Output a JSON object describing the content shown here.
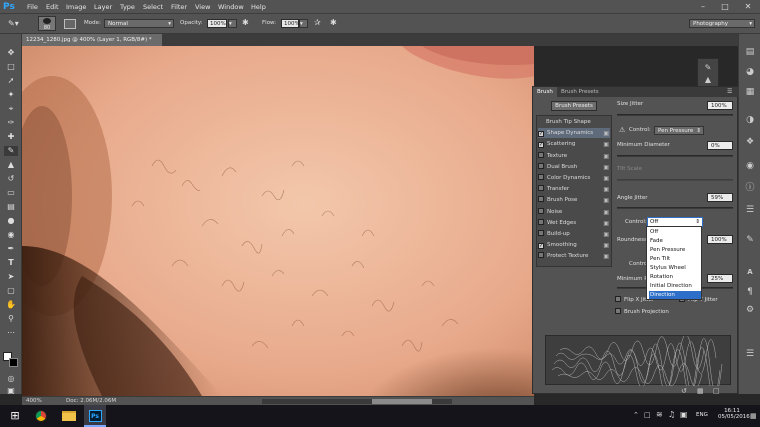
{
  "app": {
    "logo": "Ps"
  },
  "menu": [
    "File",
    "Edit",
    "Image",
    "Layer",
    "Type",
    "Select",
    "Filter",
    "View",
    "Window",
    "Help"
  ],
  "window_controls": {
    "minimize": "–",
    "maximize": "□",
    "close": "✕"
  },
  "workspace": {
    "selected": "Photography"
  },
  "options": {
    "brush_size": "80",
    "mode_label": "Mode:",
    "mode_value": "Normal",
    "opacity_label": "Opacity:",
    "opacity_value": "100%",
    "flow_label": "Flow:",
    "flow_value": "100%"
  },
  "document_tab": {
    "title": "12234_1280.jpg @ 400% (Layer 1, RGB/8#) *",
    "close": "×"
  },
  "status": {
    "zoom": "400%",
    "doc": "Doc: 2.06M/2.06M"
  },
  "brush_panel": {
    "tabs": [
      "Brush",
      "Brush Presets"
    ],
    "presets_button": "Brush Presets",
    "items": [
      {
        "label": "Brush Tip Shape",
        "checkbox": false,
        "checked": false
      },
      {
        "label": "Shape Dynamics",
        "checkbox": true,
        "checked": true,
        "selected": true
      },
      {
        "label": "Scattering",
        "checkbox": true,
        "checked": true
      },
      {
        "label": "Texture",
        "checkbox": true,
        "checked": false
      },
      {
        "label": "Dual Brush",
        "checkbox": true,
        "checked": false
      },
      {
        "label": "Color Dynamics",
        "checkbox": true,
        "checked": false
      },
      {
        "label": "Transfer",
        "checkbox": true,
        "checked": false
      },
      {
        "label": "Brush Pose",
        "checkbox": true,
        "checked": false
      },
      {
        "label": "Noise",
        "checkbox": true,
        "checked": false
      },
      {
        "label": "Wet Edges",
        "checkbox": true,
        "checked": false
      },
      {
        "label": "Build-up",
        "checkbox": true,
        "checked": false
      },
      {
        "label": "Smoothing",
        "checkbox": true,
        "checked": true
      },
      {
        "label": "Protect Texture",
        "checkbox": true,
        "checked": false
      }
    ],
    "size_jitter": {
      "label": "Size Jitter",
      "value": "100%"
    },
    "control1": {
      "label": "Control:",
      "value": "Pen Pressure"
    },
    "min_diameter": {
      "label": "Minimum Diameter",
      "value": "0%"
    },
    "tilt_scale": {
      "label": "Tilt Scale"
    },
    "angle_jitter": {
      "label": "Angle Jitter",
      "value": "59%"
    },
    "control2": {
      "label": "Control:",
      "value": "Off"
    },
    "roundness": {
      "label": "Roundness",
      "value": "100%"
    },
    "control3": {
      "label": "Control"
    },
    "min_roundness": {
      "label": "Minimum R",
      "value": "25%"
    },
    "flip_x": "Flip X Jitter",
    "flip_y": "Flip Y Jitter",
    "brush_projection": "Brush Projection"
  },
  "control_options": [
    "Off",
    "Fade",
    "Pen Pressure",
    "Pen Tilt",
    "Stylus Wheel",
    "Rotation",
    "Initial Direction",
    "Direction"
  ],
  "control_options_highlighted": "Direction",
  "taskbar": {
    "start": "⊞",
    "lang": "ENG",
    "time": "16:11",
    "date": "05/05/2016",
    "ps_label": "Ps"
  }
}
